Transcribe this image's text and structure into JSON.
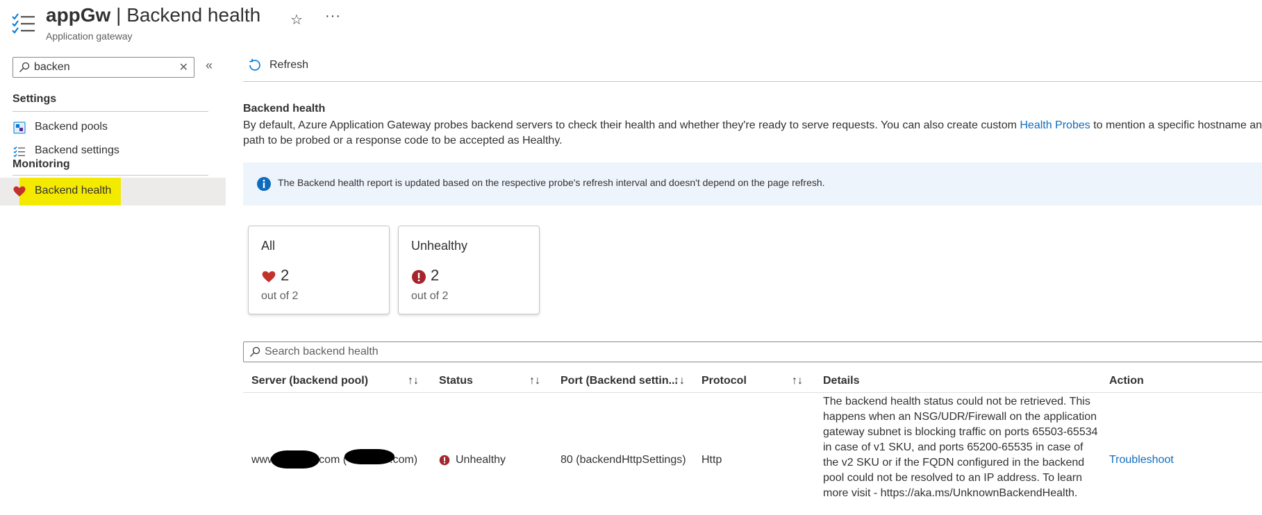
{
  "header": {
    "resource_name": "appGw",
    "separator": " | ",
    "page_name": "Backend health",
    "subtitle": "Application gateway",
    "icons": {
      "app": "checklist-icon",
      "favorite": "star-icon",
      "more": "ellipsis-icon"
    }
  },
  "sidebar": {
    "search": {
      "value": "backen",
      "clear_icon": "close-icon"
    },
    "collapse_icon": "chevron-double-left-icon",
    "sections": [
      {
        "title": "Settings",
        "items": [
          {
            "label": "Backend pools",
            "icon": "backend-pools-icon"
          },
          {
            "label": "Backend settings",
            "icon": "settings-list-icon"
          }
        ]
      },
      {
        "title": "Monitoring",
        "items": [
          {
            "label": "Backend health",
            "icon": "heart-icon",
            "active": true,
            "highlight_color": "#f4ea00"
          }
        ]
      }
    ]
  },
  "toolbar": {
    "refresh_label": "Refresh"
  },
  "content": {
    "title": "Backend health",
    "description_pre": "By default, Azure Application Gateway probes backend servers to check their health and whether they're ready to serve requests. You can also create custom ",
    "description_link": "Health Probes",
    "description_post": " to mention a specific hostname and path to be probed or a response code to be accepted as Healthy.",
    "info_banner": "The Backend health report is updated based on the respective probe's refresh interval and doesn't depend on the page refresh."
  },
  "cards": [
    {
      "title": "All",
      "count": "2",
      "sub": "out of 2",
      "icon": "heart-icon"
    },
    {
      "title": "Unhealthy",
      "count": "2",
      "sub": "out of 2",
      "icon": "error-icon"
    }
  ],
  "table": {
    "search_placeholder": "Search backend health",
    "columns": [
      "Server (backend pool)",
      "Status",
      "Port (Backend settin...",
      "Protocol",
      "Details",
      "Action"
    ],
    "rows": [
      {
        "server_start": "www",
        "server_mid": ".com (",
        "server_end": ".com)",
        "status": "Unhealthy",
        "port": "80 (backendHttpSettings)",
        "protocol": "Http",
        "details": "The backend health status could not be retrieved. This happens when an NSG/UDR/Firewall on the application gateway subnet is blocking traffic on ports 65503-65534 in case of v1 SKU, and ports 65200-65535 in case of the v2 SKU or if the FQDN configured in the backend pool could not be resolved to an IP address. To learn more visit - https://aka.ms/UnknownBackendHealth.",
        "action": "Troubleshoot"
      }
    ]
  },
  "colors": {
    "accent": "#0f6cbd",
    "heart": "#c4302b",
    "error": "#a4262c",
    "highlight": "#f4ea00",
    "banner_bg": "#eef4fc"
  }
}
